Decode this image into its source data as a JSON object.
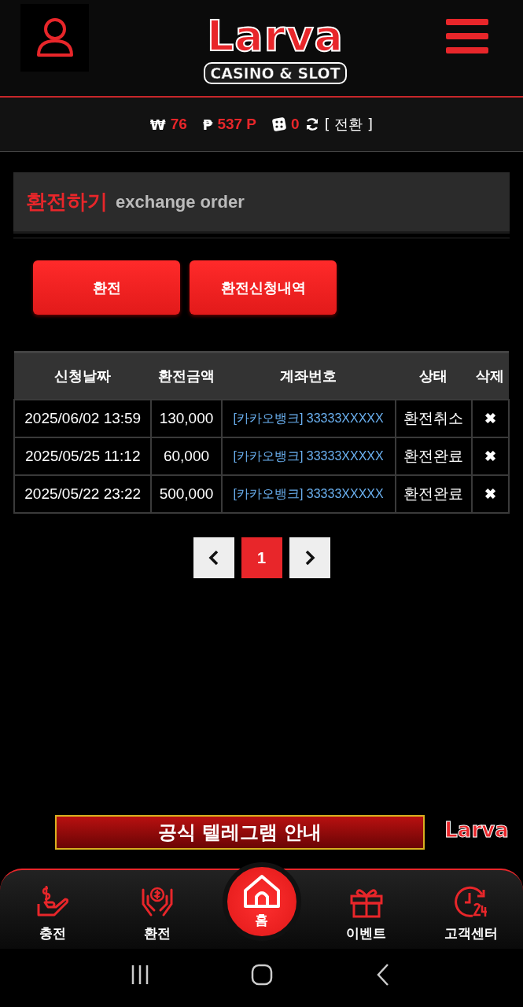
{
  "header": {
    "logo_word": "Larva",
    "logo_tagline": "CASINO & SLOT"
  },
  "balance": {
    "won_symbol": "₩",
    "won": "76",
    "point_symbol": "₱",
    "points": "537 P",
    "dice": "0",
    "switch": "[ 전환 ]"
  },
  "section": {
    "title": "환전하기",
    "subtitle": "exchange order"
  },
  "actions": [
    {
      "label": "환전"
    },
    {
      "label": "환전신청내역"
    }
  ],
  "table": {
    "columns": [
      "신청날짜",
      "환전금액",
      "계좌번호",
      "상태",
      "삭제"
    ],
    "rows": [
      {
        "date": "2025/06/02 13:59",
        "amount": "130,000",
        "account": "[카카오뱅크] 33333XXXXX",
        "status": "환전취소",
        "delete": "✖"
      },
      {
        "date": "2025/05/25 11:12",
        "amount": "60,000",
        "account": "[카카오뱅크] 33333XXXXX",
        "status": "환전완료",
        "delete": "✖"
      },
      {
        "date": "2025/05/22 23:22",
        "amount": "500,000",
        "account": "[카카오뱅크] 33333XXXXX",
        "status": "환전완료",
        "delete": "✖"
      }
    ]
  },
  "pagination": {
    "pages": [
      {
        "label": "1",
        "selected": true
      }
    ]
  },
  "banner": {
    "text": "공식 텔레그램 안내"
  },
  "floating_logo": {
    "text": "Larva"
  },
  "bottom_nav": [
    {
      "label": "충전",
      "kind": "deposit",
      "selected": false
    },
    {
      "label": "환전",
      "kind": "withdraw",
      "selected": false
    },
    {
      "label": "홈",
      "kind": "home",
      "selected": true
    },
    {
      "label": "이벤트",
      "kind": "event",
      "selected": false
    },
    {
      "label": "고객센터",
      "kind": "support",
      "selected": false
    }
  ]
}
